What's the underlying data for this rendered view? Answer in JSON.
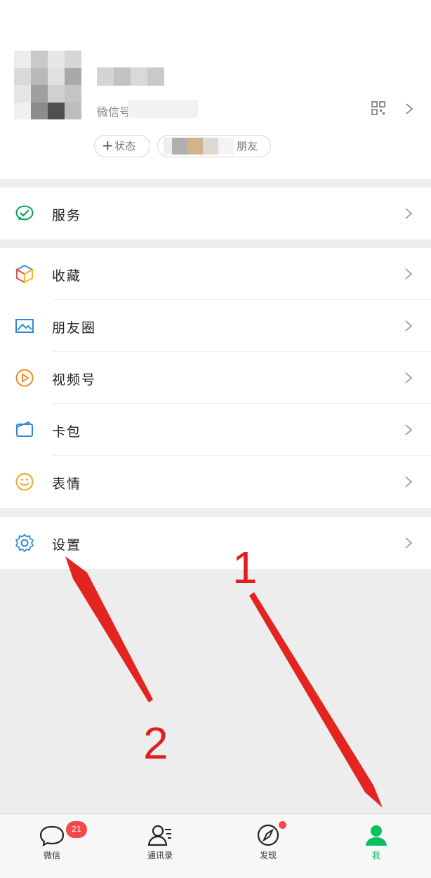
{
  "profile": {
    "wechat_id_label": "微信号",
    "status_button": "+ 状态",
    "status_text": "状态",
    "friends_pill_text": "朋友"
  },
  "menu": {
    "services": "服务",
    "favorites": "收藏",
    "moments": "朋友圈",
    "channels": "视频号",
    "cards": "卡包",
    "stickers": "表情",
    "settings": "设置"
  },
  "annotations": {
    "step1": "1",
    "step2": "2"
  },
  "tabbar": {
    "chats": "微信",
    "chats_badge": "21",
    "contacts": "通讯录",
    "discover": "发现",
    "me": "我",
    "active_tab": "me",
    "active_color": "#07c160"
  },
  "colors": {
    "annotation_red": "#e0201f",
    "badge_red": "#f24a4a"
  }
}
